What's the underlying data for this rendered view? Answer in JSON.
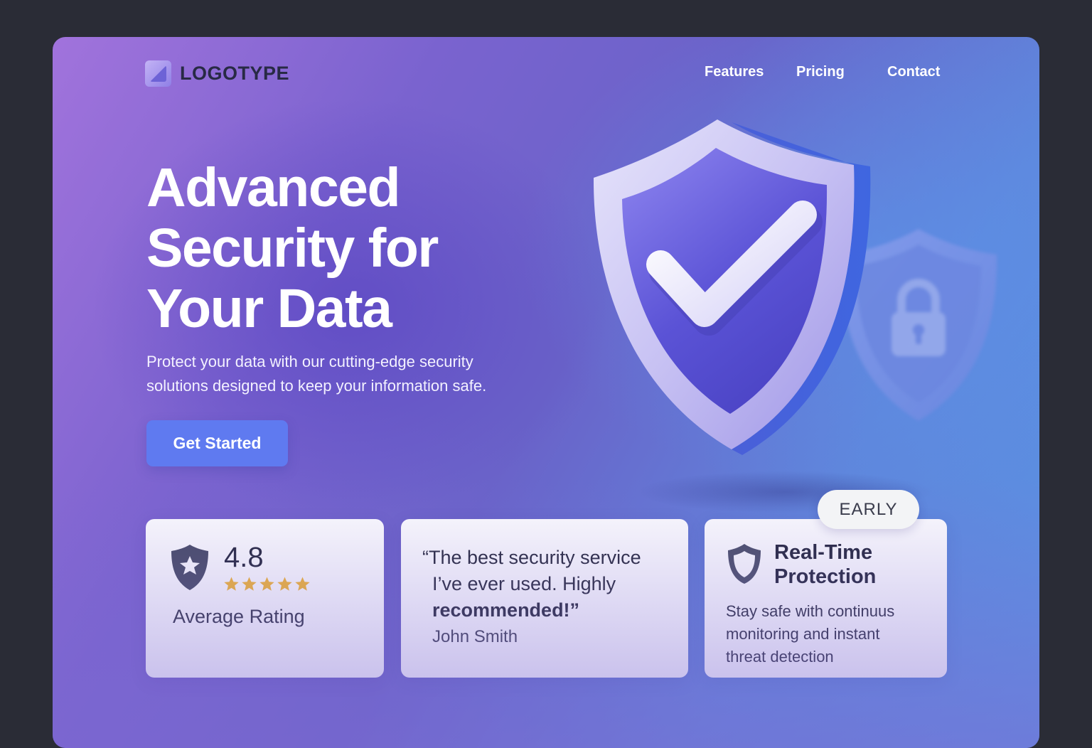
{
  "header": {
    "logo_text": "LOGOTYPE",
    "nav": [
      {
        "label": "Features"
      },
      {
        "label": "Pricing"
      },
      {
        "label": "Contact"
      }
    ]
  },
  "hero": {
    "title_lines": [
      "Advanced",
      "Security for",
      "Your Data"
    ],
    "subtitle_lines": [
      "Protect your data with our cutting-edge security",
      "solutions designed to keep your information safe."
    ],
    "cta_label": "Get Started",
    "illustration": {
      "main": "shield-check-icon",
      "secondary": "shield-lock-icon"
    }
  },
  "cards": {
    "rating": {
      "value": "4.8",
      "stars": 5,
      "label": "Average Rating",
      "icon": "shield-star-icon"
    },
    "testimonial": {
      "quote_lines": [
        "“The best security service",
        "I’ve ever used. Highly",
        "recommended!”"
      ],
      "author": "John Smith"
    },
    "protection": {
      "badge": "EARLY",
      "icon": "shield-outline-icon",
      "title_lines": [
        "Real-Time",
        "Protection"
      ],
      "desc_lines": [
        "Stay safe with continuus",
        "monitoring and instant",
        "threat detection"
      ]
    }
  },
  "colors": {
    "accent": "#5f7af0",
    "star": "#f5b731",
    "gradient_start": "#a173dc",
    "gradient_end": "#5a93e4",
    "text_dark": "#23253a"
  }
}
